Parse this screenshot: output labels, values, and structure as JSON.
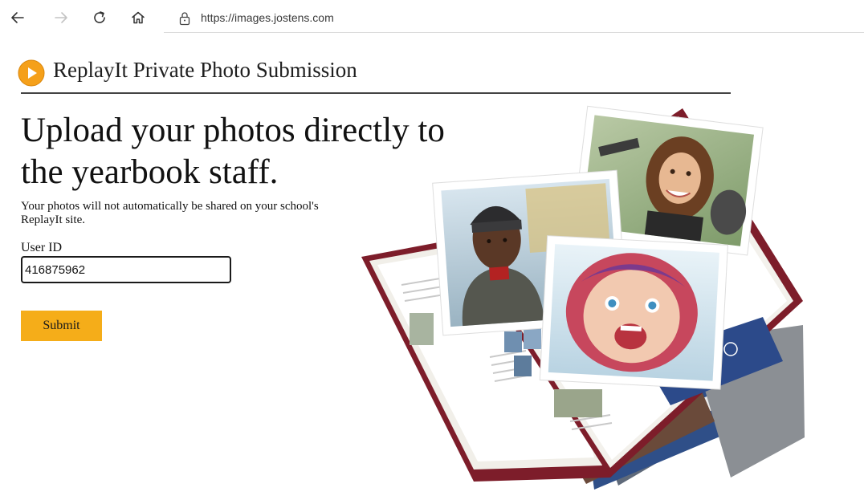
{
  "browser": {
    "url": "https://images.jostens.com",
    "icons": [
      "back-arrow-icon",
      "forward-arrow-icon",
      "refresh-icon",
      "home-icon",
      "lock-icon"
    ]
  },
  "header": {
    "title": "ReplayIt Private Photo Submission",
    "logo_color": "#f5a01a"
  },
  "main": {
    "headline": "Upload your photos directly to the yearbook staff.",
    "subtext": "Your photos will not automatically be shared on your school's ReplayIt site.",
    "user_id_label": "User ID",
    "user_id_value": "416875962",
    "submit_label": "Submit",
    "accent_color": "#f5ad19"
  }
}
